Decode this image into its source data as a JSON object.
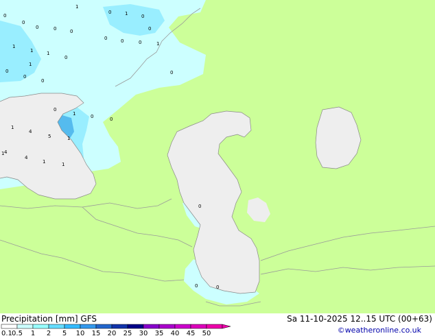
{
  "header": {
    "product": "Precipitation [mm]",
    "model": "GFS",
    "datetime": "Sa 11-10-2025 12..15 UTC (00+63)"
  },
  "credit": "©weatheronline.co.uk",
  "legend": {
    "labels": [
      "0.1",
      "0.5",
      "1",
      "2",
      "5",
      "10",
      "15",
      "20",
      "25",
      "30",
      "35",
      "40",
      "45",
      "50"
    ],
    "colors": [
      "#ffffff",
      "#ccffff",
      "#99ffff",
      "#66ddff",
      "#33bbff",
      "#3399ee",
      "#2266cc",
      "#1133aa",
      "#000088",
      "#8800cc",
      "#aa00cc",
      "#cc00cc",
      "#dd00bb",
      "#ee00aa"
    ]
  },
  "colors": {
    "land": "#ccff99",
    "water": "#eeeeee",
    "precip_light": "#ccffff",
    "precip_medium": "#99eeff",
    "precip_heavy": "#55bbee",
    "precip_strong": "#3399dd"
  },
  "values": {
    "upper_left": [
      "0",
      "0",
      "0",
      "1",
      "0",
      "1",
      "0",
      "1",
      "0",
      "0",
      "0",
      "0",
      "1",
      "1",
      "1",
      "0",
      "0",
      "0",
      "0",
      "1",
      "0",
      "0",
      "0"
    ],
    "black_sea": [
      "0",
      "0",
      "1",
      "0",
      "1",
      "4",
      "5",
      "1",
      "1",
      "4",
      "4",
      "1",
      "1"
    ],
    "caspian": [
      "0",
      "0",
      "0"
    ]
  }
}
